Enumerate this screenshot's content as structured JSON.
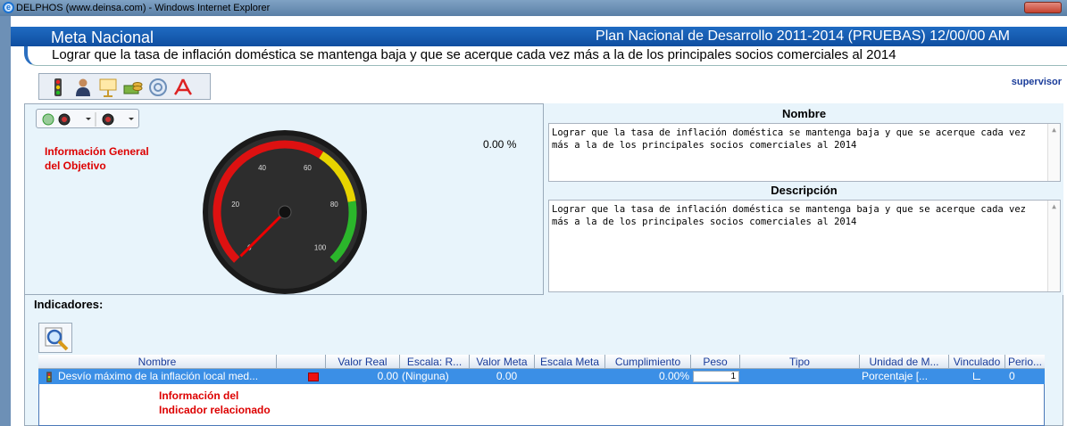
{
  "window": {
    "title": "DELPHOS (www.deinsa.com) - Windows Internet Explorer"
  },
  "header": {
    "meta_title": "Meta Nacional",
    "plan_title": "Plan Nacional de Desarrollo 2011-2014 (PRUEBAS) 12/00/00 AM"
  },
  "objective": "Lograr que la tasa de inflación doméstica se mantenga baja y que se acerque cada vez más a la de los principales socios comerciales al 2014",
  "user": "supervisor",
  "toolbar": {
    "icons": [
      "traffic-light-icon",
      "user-icon",
      "presentation-icon",
      "money-icon",
      "help-icon",
      "pdf-icon"
    ]
  },
  "gauge": {
    "value_label": "0.00 %",
    "ticks": [
      "0",
      "20",
      "40",
      "60",
      "80",
      "100"
    ],
    "value": 0,
    "colors": {
      "red": "#d11",
      "yellow": "#e8d400",
      "green": "#2bb62b"
    }
  },
  "labels": {
    "info_general_1": "Información General",
    "info_general_2": "del Objetivo",
    "info_ind_1": "Información del",
    "info_ind_2": "Indicador relacionado"
  },
  "nombre": {
    "heading": "Nombre",
    "text": "Lograr que la tasa de inflación doméstica se mantenga baja y que se acerque cada vez más a la de los principales socios comerciales al 2014"
  },
  "descripcion": {
    "heading": "Descripción",
    "text": "Lograr que la tasa de inflación doméstica se mantenga baja y que se acerque cada vez más a la de los principales socios comerciales al 2014"
  },
  "indicadores": {
    "label": "Indicadores:",
    "columns": [
      "Nombre",
      "",
      "Valor Real",
      "Escala: R...",
      "Valor Meta",
      "Escala Meta",
      "Cumplimiento",
      "Peso",
      "Tipo",
      "Unidad de M...",
      "Vinculado",
      "Perio..."
    ],
    "row": {
      "nombre": "Desvío máximo de la inflación local med...",
      "valor_real": "0.00",
      "escala_real": "(Ninguna)",
      "valor_meta": "0.00",
      "escala_meta": "",
      "cumplimiento": "0.00%",
      "peso": "1",
      "tipo": "",
      "unidad": "Porcentaje [...",
      "vinculado": "",
      "periodo": "0"
    }
  }
}
